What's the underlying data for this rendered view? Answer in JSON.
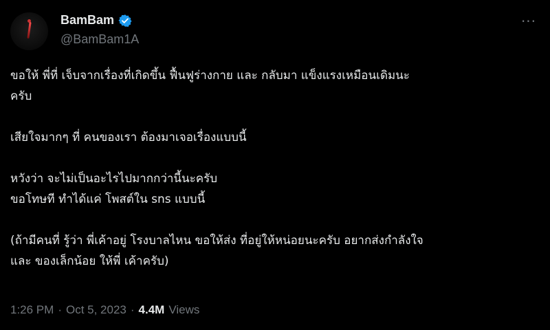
{
  "author": {
    "display_name": "BamBam",
    "handle": "@BamBam1A",
    "verified": true,
    "verified_color": "#1d9bf0"
  },
  "more_menu": {
    "icon": "more-dots-icon",
    "label": "···"
  },
  "tweet": {
    "paragraphs": [
      [
        "ขอให้ พี่ที่ เจ็บจากเรื่องที่เกิดขึ้น ฟื้นฟูร่างกาย และ กลับมา แข็งแรงเหมือนเดิมนะ",
        "ครับ"
      ],
      [
        "เสียใจมากๆ ที่ คนของเรา ต้องมาเจอเรื่องแบบนี้"
      ],
      [
        "หวังว่า จะไม่เป็นอะไรไปมากกว่านี้นะครับ",
        "ขอโทษที ทำได้แค่ โพสต์ใน sns แบบนี้"
      ],
      [
        "(ถ้ามีคนที่ รู้ว่า พี่เค้าอยู่ โรงบาลไหน ขอให้ส่ง ที่อยู่ให้หน่อยนะครับ อยากส่งกำลังใจ",
        "และ ของเล็กน้อย ให้พี่ เค้าครับ)"
      ]
    ]
  },
  "meta": {
    "time": "1:26 PM",
    "separator": "·",
    "date": "Oct 5, 2023",
    "views_count": "4.4M",
    "views_label": "Views"
  }
}
